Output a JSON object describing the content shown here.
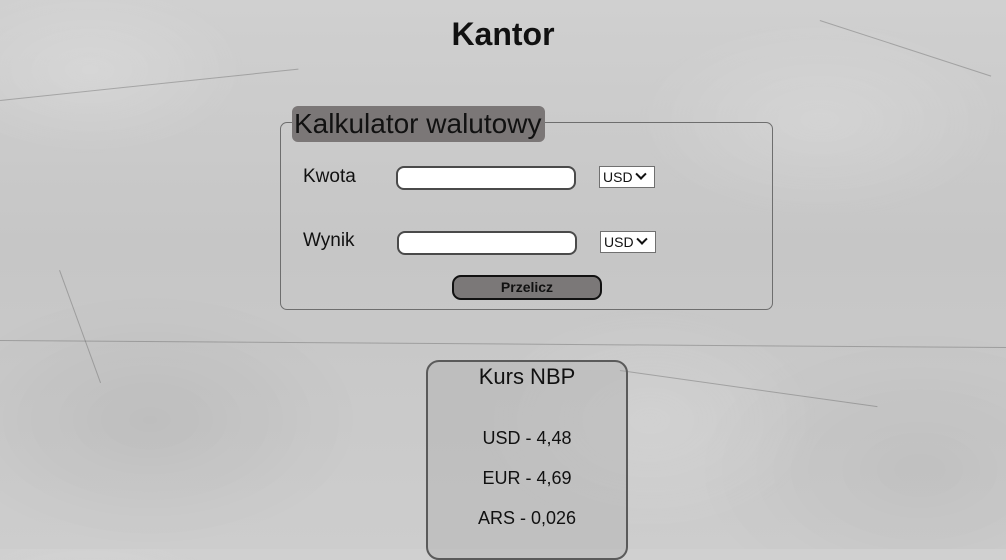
{
  "page": {
    "title": "Kantor"
  },
  "calculator": {
    "legend": "Kalkulator walutowy",
    "amount": {
      "label": "Kwota",
      "value": "",
      "currency": "USD"
    },
    "result": {
      "label": "Wynik",
      "value": "",
      "currency": "USD"
    },
    "button_label": "Przelicz"
  },
  "rates": {
    "title": "Kurs NBP",
    "items": [
      {
        "text": "USD - 4,48"
      },
      {
        "text": "EUR - 4,69"
      },
      {
        "text": "ARS - 0,026"
      }
    ]
  }
}
